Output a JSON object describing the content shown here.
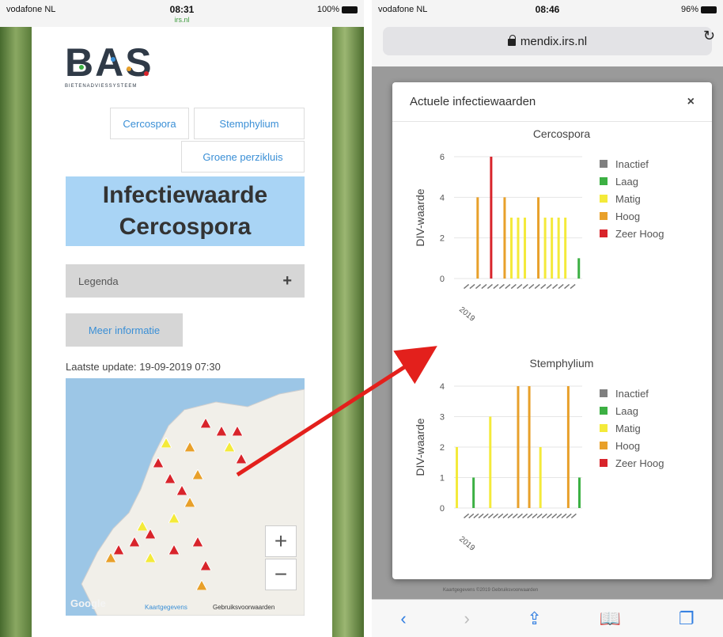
{
  "left": {
    "status": {
      "carrier": "vodafone NL",
      "time": "08:31",
      "battery": "100%",
      "subdomain": "irs.nl"
    },
    "logo": {
      "text": "BAS",
      "subtitle": "BIETENADVIESSYSTEEM"
    },
    "links": [
      "Cercospora",
      "Stemphylium",
      "Groene perzikluis"
    ],
    "title_line1": "Infectiewaarde",
    "title_line2": "Cercospora",
    "legend_label": "Legenda",
    "legend_toggle": "+",
    "info_button": "Meer informatie",
    "last_update": "Laatste update: 19-09-2019 07:30",
    "map": {
      "zoom_in": "+",
      "zoom_out": "−",
      "google": "Google",
      "map_data": "Kaartgegevens",
      "terms": "Gebruiksvoorwaarden"
    }
  },
  "right": {
    "status": {
      "carrier": "vodafone NL",
      "time": "08:46",
      "battery": "96%"
    },
    "url": "mendix.irs.nl",
    "modal_title": "Actuele infectiewaarden",
    "close": "×",
    "footer_text": "Kaartgegevens ©2019   Gebruiksvoorwaarden",
    "toolbar": {
      "back": "‹",
      "forward": "›",
      "share": "⇪",
      "bookmarks": "📖",
      "tabs": "❐"
    }
  },
  "legend_colors": {
    "Inactief": "#7f7f7f",
    "Laag": "#3cb043",
    "Matig": "#f4ea3a",
    "Hoog": "#e8a02a",
    "Zeer Hoog": "#d8242b"
  },
  "chart_data": [
    {
      "type": "bar",
      "title": "Cercospora",
      "ylabel": "DIV-waarde",
      "ylim": [
        0,
        6
      ],
      "yticks": [
        0,
        2,
        4,
        6
      ],
      "legend": [
        "Inactief",
        "Laag",
        "Matig",
        "Hoog",
        "Zeer Hoog"
      ],
      "x_label_lead": "2019",
      "values": [
        0,
        0,
        0,
        4,
        0,
        6,
        0,
        4,
        3,
        3,
        3,
        0,
        4,
        3,
        3,
        3,
        3,
        0,
        1
      ],
      "levels": [
        "",
        "",
        "",
        "Hoog",
        "",
        "Zeer Hoog",
        "",
        "Hoog",
        "Matig",
        "Matig",
        "Matig",
        "",
        "Hoog",
        "Matig",
        "Matig",
        "Matig",
        "Matig",
        "",
        "Laag"
      ]
    },
    {
      "type": "bar",
      "title": "Stemphylium",
      "ylabel": "DIV-waarde",
      "ylim": [
        0,
        4
      ],
      "yticks": [
        0,
        1,
        2,
        3,
        4
      ],
      "legend": [
        "Inactief",
        "Laag",
        "Matig",
        "Hoog",
        "Zeer Hoog"
      ],
      "x_label_lead": "2019",
      "values": [
        2,
        0,
        0,
        1,
        0,
        0,
        3,
        0,
        0,
        0,
        0,
        4,
        0,
        4,
        0,
        2,
        0,
        0,
        0,
        0,
        4,
        0,
        1
      ],
      "levels": [
        "Matig",
        "",
        "",
        "Laag",
        "",
        "",
        "Matig",
        "",
        "",
        "",
        "",
        "Hoog",
        "",
        "Hoog",
        "",
        "Matig",
        "",
        "",
        "",
        "",
        "Hoog",
        "",
        "Laag"
      ]
    }
  ]
}
